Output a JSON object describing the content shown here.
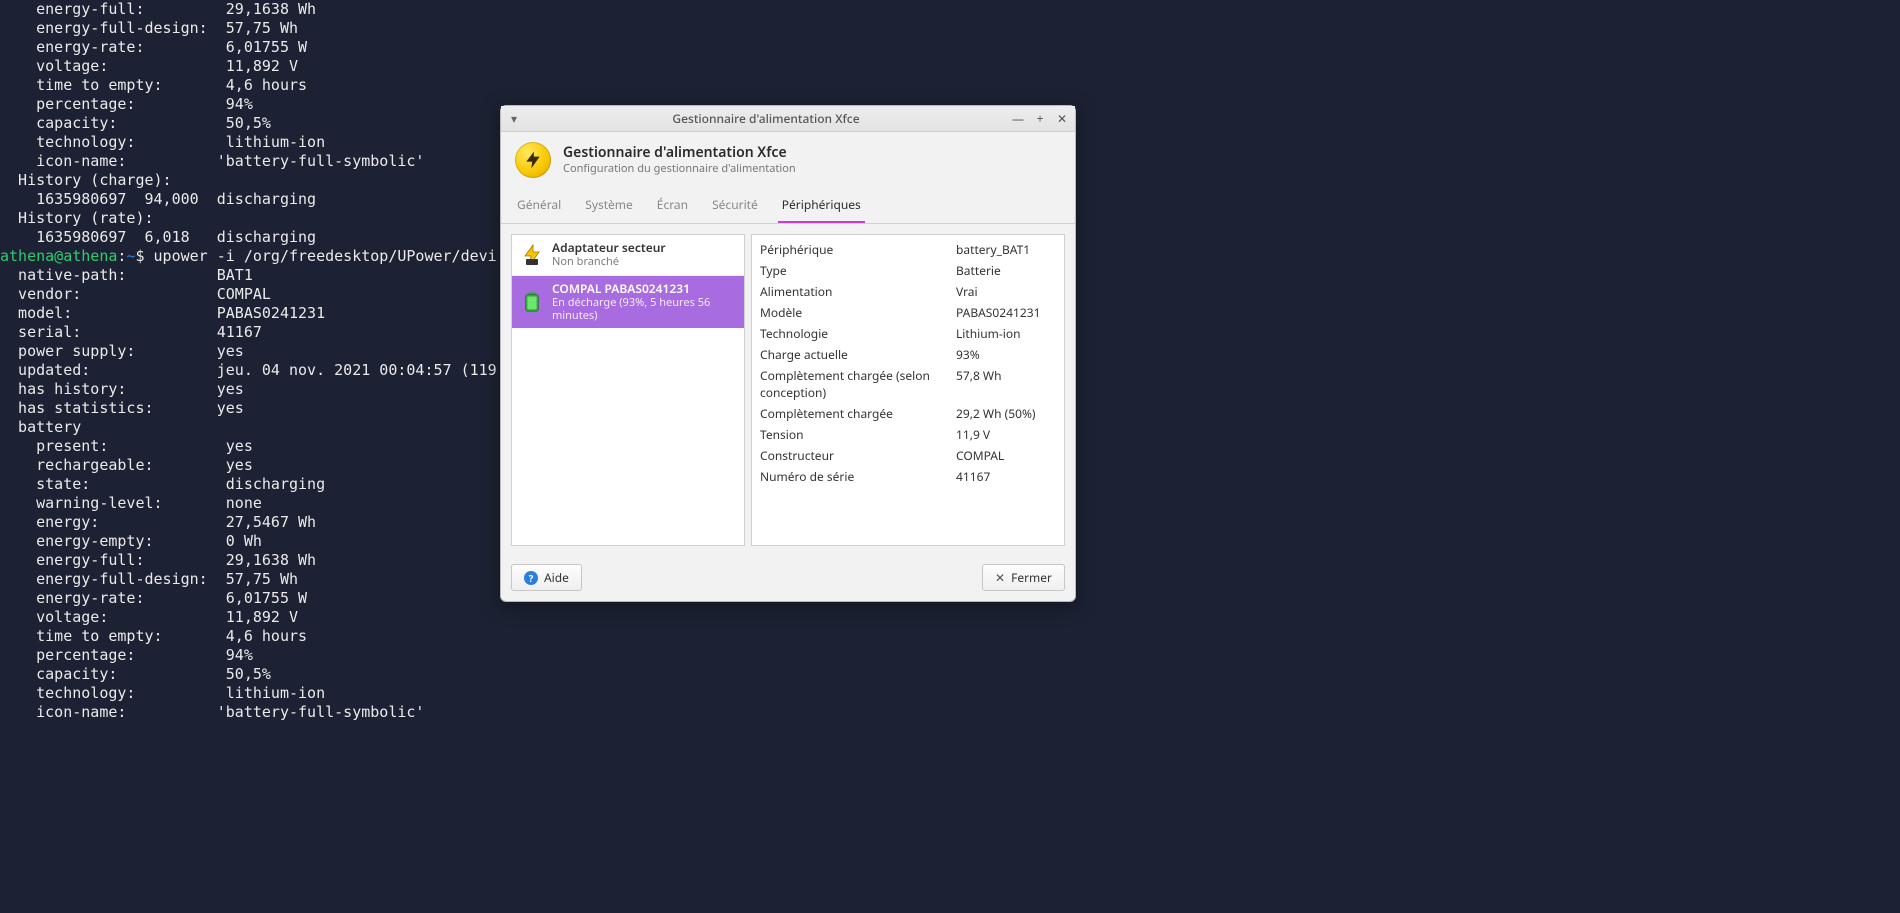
{
  "terminal": {
    "lines_top": [
      "    energy-full:         29,1638 Wh",
      "    energy-full-design:  57,75 Wh",
      "    energy-rate:         6,01755 W",
      "    voltage:             11,892 V",
      "    time to empty:       4,6 hours",
      "    percentage:          94%",
      "    capacity:            50,5%",
      "    technology:          lithium-ion",
      "    icon-name:          'battery-full-symbolic'",
      "  History (charge):",
      "    1635980697  94,000  discharging",
      "  History (rate):",
      "    1635980697  6,018   discharging",
      ""
    ],
    "prompt_user": "athena@athena",
    "prompt_path": "~",
    "prompt_symbol": "$",
    "command": "upower -i /org/freedesktop/UPower/devi",
    "lines_bottom": [
      "  native-path:          BAT1",
      "  vendor:               COMPAL",
      "  model:                PABAS0241231",
      "  serial:               41167",
      "  power supply:         yes",
      "  updated:              jeu. 04 nov. 2021 00:04:57 (119",
      "  has history:          yes",
      "  has statistics:       yes",
      "  battery",
      "    present:             yes",
      "    rechargeable:        yes",
      "    state:               discharging",
      "    warning-level:       none",
      "    energy:              27,5467 Wh",
      "    energy-empty:        0 Wh",
      "    energy-full:         29,1638 Wh",
      "    energy-full-design:  57,75 Wh",
      "    energy-rate:         6,01755 W",
      "    voltage:             11,892 V",
      "    time to empty:       4,6 hours",
      "    percentage:          94%",
      "    capacity:            50,5%",
      "    technology:          lithium-ion",
      "    icon-name:          'battery-full-symbolic'"
    ]
  },
  "window": {
    "title": "Gestionnaire d'alimentation Xfce",
    "app_title": "Gestionnaire d'alimentation Xfce",
    "app_subtitle": "Configuration du gestionnaire d'alimentation",
    "tabs": {
      "general": "Général",
      "system": "Système",
      "display": "Écran",
      "security": "Sécurité",
      "devices": "Périphériques"
    },
    "devices": {
      "adapter": {
        "title": "Adaptateur secteur",
        "sub": "Non branché"
      },
      "battery": {
        "title": "COMPAL PABAS0241231",
        "sub": "En décharge (93%, 5 heures 56 minutes)"
      }
    },
    "details": [
      {
        "k": "Périphérique",
        "v": "battery_BAT1"
      },
      {
        "k": "Type",
        "v": "Batterie"
      },
      {
        "k": "Alimentation",
        "v": "Vrai"
      },
      {
        "k": "Modèle",
        "v": "PABAS0241231"
      },
      {
        "k": "Technologie",
        "v": "Lithium-ion"
      },
      {
        "k": "Charge actuelle",
        "v": "93%"
      },
      {
        "k": "Complètement chargée (selon conception)",
        "v": "57,8 Wh"
      },
      {
        "k": "Complètement chargée",
        "v": "29,2 Wh (50%)"
      },
      {
        "k": "Tension",
        "v": "11,9 V"
      },
      {
        "k": "Constructeur",
        "v": "COMPAL"
      },
      {
        "k": "Numéro de série",
        "v": "41167"
      }
    ],
    "buttons": {
      "help": "Aide",
      "close": "Fermer"
    }
  }
}
